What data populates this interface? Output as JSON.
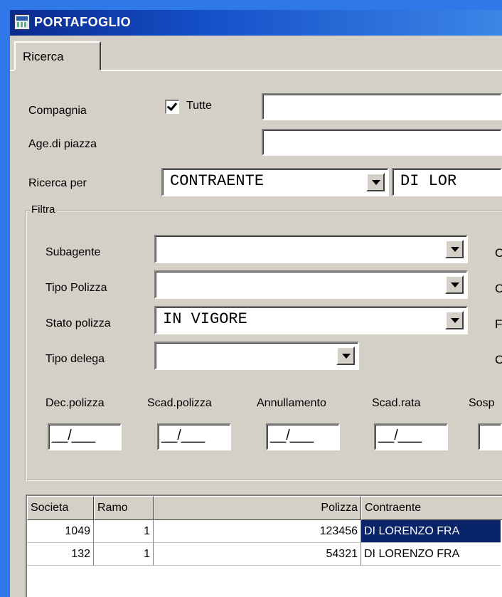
{
  "window": {
    "title": "PORTAFOGLIO"
  },
  "tabs": [
    {
      "label": "Ricerca"
    }
  ],
  "form": {
    "compagnia_label": "Compagnia",
    "tutte_label": "Tutte",
    "tutte_checked": true,
    "compagnia_value": "",
    "age_label": "Age.di piazza",
    "age_value": "",
    "ricerca_per_label": "Ricerca per",
    "ricerca_per_value": "CONTRAENTE",
    "ricerca_text": "DI LOR"
  },
  "filtra": {
    "label": "Filtra",
    "subagente_label": "Subagente",
    "subagente_value": "",
    "tipo_polizza_label": "Tipo Polizza",
    "tipo_polizza_value": "",
    "stato_polizza_label": "Stato polizza",
    "stato_polizza_value": "IN VIGORE",
    "tipo_delega_label": "Tipo delega",
    "tipo_delega_value": "",
    "right_cut_labels": [
      "C",
      "C",
      "F",
      "C"
    ],
    "date_fields": [
      {
        "label": "Dec.polizza",
        "value": "__/___"
      },
      {
        "label": "Scad.polizza",
        "value": "__/___"
      },
      {
        "label": "Annullamento",
        "value": "__/___"
      },
      {
        "label": "Scad.rata",
        "value": "__/___"
      },
      {
        "label": "Sosp",
        "value": ""
      }
    ]
  },
  "table": {
    "columns": [
      "Societa",
      "Ramo",
      "Polizza",
      "Contraente"
    ],
    "rows": [
      {
        "societa": "1049",
        "ramo": "1",
        "polizza": "123456",
        "contraente": "DI LORENZO FRA",
        "selected": true
      },
      {
        "societa": "132",
        "ramo": "1",
        "polizza": "54321",
        "contraente": "DI LORENZO FRA",
        "selected": false
      }
    ]
  },
  "icons": {
    "app": "app-icon",
    "checkbox": "checkmark-icon",
    "dropdown": "chevron-down-icon"
  },
  "colors": {
    "titlebar": "#0a246a",
    "selection": "#0a246a",
    "face": "#d4d0c8"
  }
}
